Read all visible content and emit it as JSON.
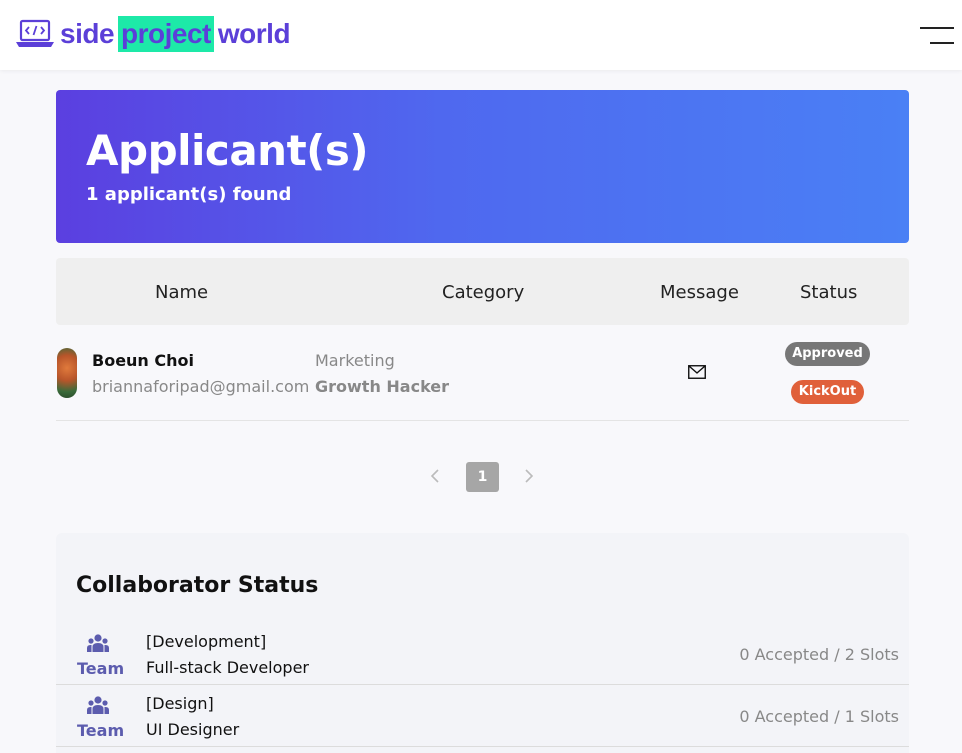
{
  "header": {
    "logo": {
      "word1": "side",
      "word2": "project",
      "word3": "world"
    },
    "menu_icon": "hamburger-icon"
  },
  "hero": {
    "title": "Applicant(s)",
    "count_text": "1 applicant(s) found"
  },
  "table": {
    "columns": [
      "Name",
      "Category",
      "Message",
      "Status"
    ],
    "rows": [
      {
        "name": "Boeun Choi",
        "email": "briannaforipad@gmail.com",
        "category": "Marketing",
        "role": "Growth Hacker",
        "message_icon": "mail-icon",
        "status": "Approved",
        "action": "KickOut"
      }
    ]
  },
  "pagination": {
    "current_page": "1"
  },
  "collaborators": {
    "title": "Collaborator Status",
    "items": [
      {
        "icon": "team-icon",
        "label": "Team",
        "category": "[Development]",
        "role": "Full-stack Developer",
        "slots": "0 Accepted / 2 Slots"
      },
      {
        "icon": "team-icon",
        "label": "Team",
        "category": "[Design]",
        "role": "UI Designer",
        "slots": "0 Accepted / 1 Slots"
      }
    ]
  },
  "colors": {
    "brand": "#5b3fd8",
    "highlight": "#1de9a8",
    "hero_start": "#5b3fe0",
    "hero_end": "#4a80f5",
    "approved": "#777777",
    "kickout": "#e0603a",
    "team": "#5c5cae"
  }
}
